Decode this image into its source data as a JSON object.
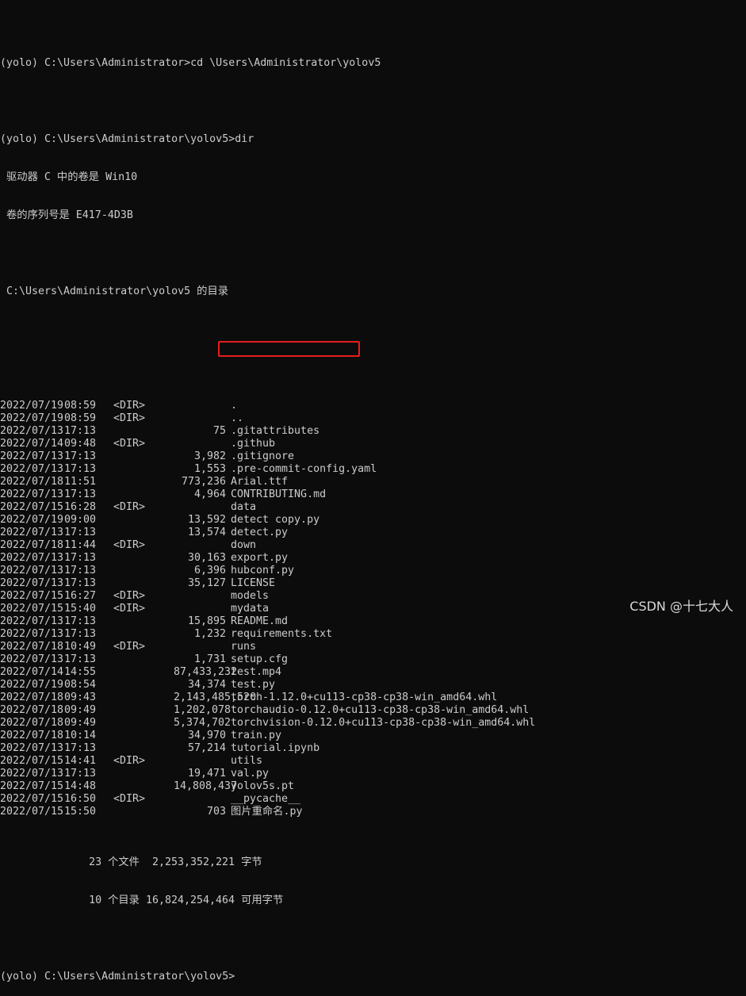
{
  "terminal": {
    "lines_top": [
      "(yolo) C:\\Users\\Administrator>cd \\Users\\Administrator\\yolov5",
      "",
      "(yolo) C:\\Users\\Administrator\\yolov5>dir",
      " 驱动器 C 中的卷是 Win10",
      " 卷的序列号是 E417-4D3B",
      "",
      " C:\\Users\\Administrator\\yolov5 的目录",
      ""
    ],
    "entries": [
      {
        "date": "2022/07/19",
        "time": "08:59",
        "dir": "<DIR>",
        "size": "",
        "name": "."
      },
      {
        "date": "2022/07/19",
        "time": "08:59",
        "dir": "<DIR>",
        "size": "",
        "name": ".."
      },
      {
        "date": "2022/07/13",
        "time": "17:13",
        "dir": "",
        "size": "75",
        "name": ".gitattributes"
      },
      {
        "date": "2022/07/14",
        "time": "09:48",
        "dir": "<DIR>",
        "size": "",
        "name": ".github"
      },
      {
        "date": "2022/07/13",
        "time": "17:13",
        "dir": "",
        "size": "3,982",
        "name": ".gitignore"
      },
      {
        "date": "2022/07/13",
        "time": "17:13",
        "dir": "",
        "size": "1,553",
        "name": ".pre-commit-config.yaml"
      },
      {
        "date": "2022/07/18",
        "time": "11:51",
        "dir": "",
        "size": "773,236",
        "name": "Arial.ttf"
      },
      {
        "date": "2022/07/13",
        "time": "17:13",
        "dir": "",
        "size": "4,964",
        "name": "CONTRIBUTING.md"
      },
      {
        "date": "2022/07/15",
        "time": "16:28",
        "dir": "<DIR>",
        "size": "",
        "name": "data"
      },
      {
        "date": "2022/07/19",
        "time": "09:00",
        "dir": "",
        "size": "13,592",
        "name": "detect copy.py"
      },
      {
        "date": "2022/07/13",
        "time": "17:13",
        "dir": "",
        "size": "13,574",
        "name": "detect.py"
      },
      {
        "date": "2022/07/18",
        "time": "11:44",
        "dir": "<DIR>",
        "size": "",
        "name": "down"
      },
      {
        "date": "2022/07/13",
        "time": "17:13",
        "dir": "",
        "size": "30,163",
        "name": "export.py"
      },
      {
        "date": "2022/07/13",
        "time": "17:13",
        "dir": "",
        "size": "6,396",
        "name": "hubconf.py"
      },
      {
        "date": "2022/07/13",
        "time": "17:13",
        "dir": "",
        "size": "35,127",
        "name": "LICENSE"
      },
      {
        "date": "2022/07/15",
        "time": "16:27",
        "dir": "<DIR>",
        "size": "",
        "name": "models"
      },
      {
        "date": "2022/07/15",
        "time": "15:40",
        "dir": "<DIR>",
        "size": "",
        "name": "mydata"
      },
      {
        "date": "2022/07/13",
        "time": "17:13",
        "dir": "",
        "size": "15,895",
        "name": "README.md"
      },
      {
        "date": "2022/07/13",
        "time": "17:13",
        "dir": "",
        "size": "1,232",
        "name": "requirements.txt"
      },
      {
        "date": "2022/07/18",
        "time": "10:49",
        "dir": "<DIR>",
        "size": "",
        "name": "runs"
      },
      {
        "date": "2022/07/13",
        "time": "17:13",
        "dir": "",
        "size": "1,731",
        "name": "setup.cfg"
      },
      {
        "date": "2022/07/14",
        "time": "14:55",
        "dir": "",
        "size": "87,433,232",
        "name": "test.mp4"
      },
      {
        "date": "2022/07/19",
        "time": "08:54",
        "dir": "",
        "size": "34,374",
        "name": "test.py"
      },
      {
        "date": "2022/07/18",
        "time": "09:43",
        "dir": "",
        "size": "2,143,485,520",
        "name": "torch-1.12.0+cu113-cp38-cp38-win_amd64.whl"
      },
      {
        "date": "2022/07/18",
        "time": "09:49",
        "dir": "",
        "size": "1,202,078",
        "name": "torchaudio-0.12.0+cu113-cp38-cp38-win_amd64.whl"
      },
      {
        "date": "2022/07/18",
        "time": "09:49",
        "dir": "",
        "size": "5,374,702",
        "name": "torchvision-0.12.0+cu113-cp38-cp38-win_amd64.whl"
      },
      {
        "date": "2022/07/18",
        "time": "10:14",
        "dir": "",
        "size": "34,970",
        "name": "train.py"
      },
      {
        "date": "2022/07/13",
        "time": "17:13",
        "dir": "",
        "size": "57,214",
        "name": "tutorial.ipynb"
      },
      {
        "date": "2022/07/15",
        "time": "14:41",
        "dir": "<DIR>",
        "size": "",
        "name": "utils"
      },
      {
        "date": "2022/07/13",
        "time": "17:13",
        "dir": "",
        "size": "19,471",
        "name": "val.py"
      },
      {
        "date": "2022/07/15",
        "time": "14:48",
        "dir": "",
        "size": "14,808,437",
        "name": "yolov5s.pt"
      },
      {
        "date": "2022/07/15",
        "time": "16:50",
        "dir": "<DIR>",
        "size": "",
        "name": "__pycache__"
      },
      {
        "date": "2022/07/15",
        "time": "15:50",
        "dir": "",
        "size": "703",
        "name": "图片重命名.py"
      }
    ],
    "summary": [
      "              23 个文件  2,253,352,221 字节",
      "              10 个目录 16,824,254,464 可用字节"
    ],
    "prompt_end": "(yolo) C:\\Users\\Administrator\\yolov5>"
  },
  "watermark": "CSDN @十七大人",
  "colors": {
    "background": "#0c0c0c",
    "text": "#cccccc",
    "highlight": "#e81d1d"
  }
}
